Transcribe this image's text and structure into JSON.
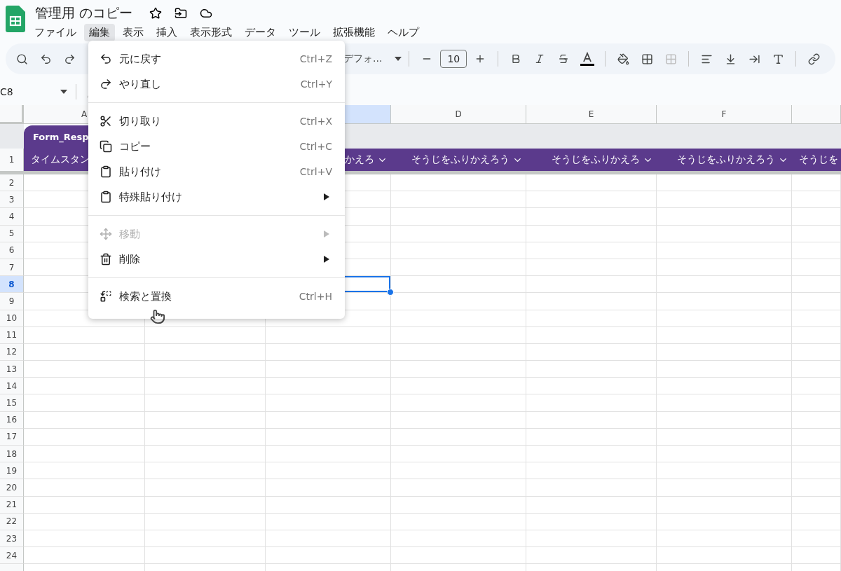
{
  "document": {
    "title": "管理用 のコピー"
  },
  "menubar": [
    {
      "label": "ファイル",
      "selected": false
    },
    {
      "label": "編集",
      "selected": true
    },
    {
      "label": "表示",
      "selected": false
    },
    {
      "label": "挿入",
      "selected": false
    },
    {
      "label": "表示形式",
      "selected": false
    },
    {
      "label": "データ",
      "selected": false
    },
    {
      "label": "ツール",
      "selected": false
    },
    {
      "label": "拡張機能",
      "selected": false
    },
    {
      "label": "ヘルプ",
      "selected": false
    }
  ],
  "toolbar": {
    "font": "デフォ...",
    "font_size": "10"
  },
  "name_box": "C8",
  "columns": [
    {
      "label": "A",
      "selected": false
    },
    {},
    {
      "selected": true
    },
    {
      "label": "D",
      "selected": false
    },
    {
      "label": "E",
      "selected": false
    },
    {
      "label": "F",
      "selected": false
    },
    {
      "selected": false
    }
  ],
  "table_name": "Form_Resp",
  "header_row": {
    "label": "1",
    "cells": [
      {
        "text": "タイムスタン"
      },
      {},
      {
        "text": "かえろ",
        "dropdown": true
      },
      {
        "text": "そうじをふりかえろう",
        "dropdown": true
      },
      {
        "text": "そうじをふりかえろ",
        "dropdown": true
      },
      {
        "text": "そうじをふりかえろう",
        "dropdown": true
      },
      {
        "text": "そうじを",
        "dropdown": false
      }
    ]
  },
  "rows": [
    {
      "label": "2",
      "selected": false
    },
    {
      "label": "3",
      "selected": false
    },
    {
      "label": "4",
      "selected": false
    },
    {
      "label": "5",
      "selected": false
    },
    {
      "label": "6",
      "selected": false
    },
    {
      "label": "7",
      "selected": false
    },
    {
      "label": "8",
      "selected": true
    },
    {
      "label": "9",
      "selected": false
    },
    {
      "label": "10",
      "selected": false
    },
    {
      "label": "11",
      "selected": false
    },
    {
      "label": "12",
      "selected": false
    },
    {
      "label": "13",
      "selected": false
    },
    {
      "label": "14",
      "selected": false
    },
    {
      "label": "15",
      "selected": false
    },
    {
      "label": "16",
      "selected": false
    },
    {
      "label": "17",
      "selected": false
    },
    {
      "label": "18",
      "selected": false
    },
    {
      "label": "19",
      "selected": false
    },
    {
      "label": "20",
      "selected": false
    },
    {
      "label": "21",
      "selected": false
    },
    {
      "label": "22",
      "selected": false
    },
    {
      "label": "23",
      "selected": false
    },
    {
      "label": "24",
      "selected": false
    }
  ],
  "edit_menu": [
    [
      {
        "label": "元に戻す",
        "shortcut": "Ctrl+Z",
        "disabled": false,
        "submenu": false
      },
      {
        "label": "やり直し",
        "shortcut": "Ctrl+Y",
        "disabled": false,
        "submenu": false
      }
    ],
    [
      {
        "label": "切り取り",
        "shortcut": "Ctrl+X",
        "disabled": false,
        "submenu": false
      },
      {
        "label": "コピー",
        "shortcut": "Ctrl+C",
        "disabled": false,
        "submenu": false
      },
      {
        "label": "貼り付け",
        "shortcut": "Ctrl+V",
        "disabled": false,
        "submenu": false
      },
      {
        "label": "特殊貼り付け",
        "disabled": false,
        "submenu": true
      }
    ],
    [
      {
        "label": "移動",
        "disabled": true,
        "submenu": true
      },
      {
        "label": "削除",
        "disabled": false,
        "submenu": true
      }
    ],
    [
      {
        "label": "検索と置換",
        "shortcut": "Ctrl+H",
        "disabled": false,
        "submenu": false
      }
    ]
  ]
}
